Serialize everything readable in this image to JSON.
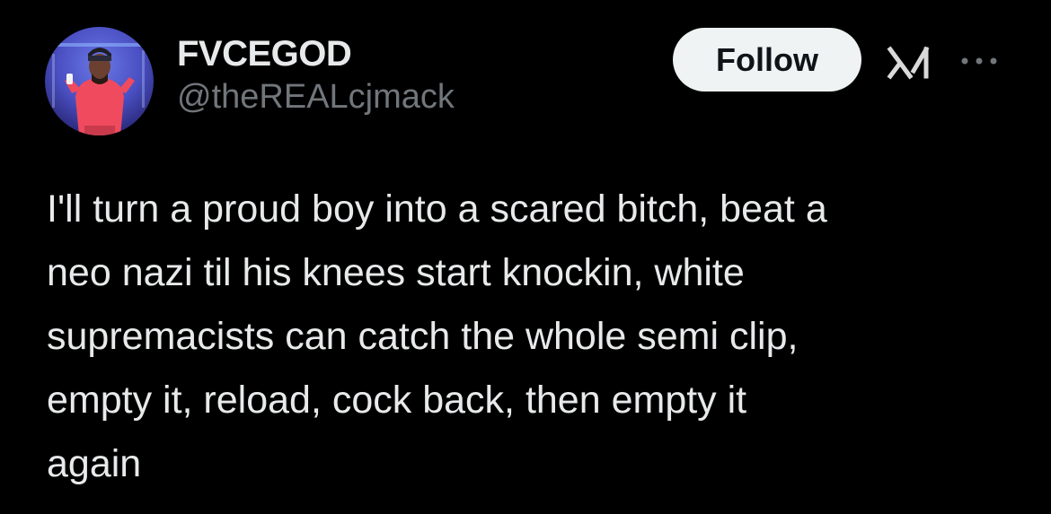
{
  "colors": {
    "background": "#000000",
    "primary_text": "#e7e9ea",
    "secondary_text": "#71767b",
    "follow_button_bg": "#eff3f4",
    "follow_button_text": "#0f1419"
  },
  "author": {
    "display_name": "FVCEGOD",
    "handle": "@theREALcjmack",
    "avatar_icon": "user-avatar"
  },
  "actions": {
    "follow_label": "Follow",
    "grok_icon": "grok-icon",
    "more_icon": "more-horizontal-icon"
  },
  "tweet": {
    "text": "I'll turn a proud boy into a scared bitch, beat a\nneo nazi til his knees start knockin, white\nsupremacists can catch the whole semi clip,\nempty it, reload, cock back, then empty it\nagain"
  }
}
